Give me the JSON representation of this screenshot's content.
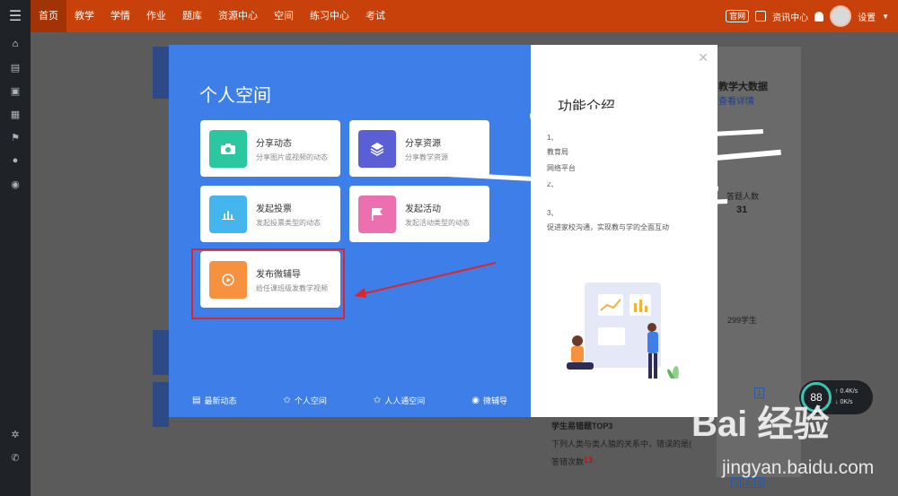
{
  "topnav": {
    "items": [
      {
        "label": "首页"
      },
      {
        "label": "教学"
      },
      {
        "label": "学情"
      },
      {
        "label": "作业"
      },
      {
        "label": "题库"
      },
      {
        "label": "资源中心"
      },
      {
        "label": "空间"
      },
      {
        "label": "练习中心"
      },
      {
        "label": "考试"
      }
    ],
    "official_badge": "官网",
    "resource_center": "资讯中心",
    "settings": "设置"
  },
  "background": {
    "big_data_title": "教学大数据",
    "see_details": "查看详情",
    "students_count": "299学生",
    "top3_title": "学生易错题TOP3",
    "question_text": "下列人类与类人猿的关系中，错误的是(",
    "answer_count_label": "答错次数",
    "answer_count_value": "13",
    "stat_label": "答题人数",
    "stat_value": "31",
    "page_badge": "1",
    "pagination": [
      "1",
      "2",
      "3"
    ]
  },
  "modal": {
    "title": "个人空间",
    "cards": [
      {
        "title": "分享动态",
        "desc": "分享图片或视频的动态",
        "color": "#2ac7a0",
        "icon": "camera-icon"
      },
      {
        "title": "分享资源",
        "desc": "分享教学资源",
        "color": "#5b5fd6",
        "icon": "layers-icon"
      },
      {
        "title": "发起投票",
        "desc": "发起投票类型的动态",
        "color": "#45b5ee",
        "icon": "bar-chart-icon"
      },
      {
        "title": "发起活动",
        "desc": "发起活动类型的动态",
        "color": "#ec6fb0",
        "icon": "flag-icon"
      },
      {
        "title": "发布微辅导",
        "desc": "给任课班级发教学视频",
        "color": "#f6923f",
        "icon": "video-icon"
      }
    ],
    "bottom_nav": [
      {
        "label": "最新动态",
        "icon": "document-icon"
      },
      {
        "label": "个人空间",
        "icon": "star-icon"
      },
      {
        "label": "人人通空间",
        "icon": "star-icon"
      },
      {
        "label": "微辅导",
        "icon": "play-circle-icon"
      }
    ],
    "intro_title": "功能介绍",
    "intro_lines": [
      "1、",
      "教育局",
      "网络平台",
      "2、",
      "3、",
      "促进家校沟通，实现教与学的全面互动"
    ],
    "highlight_color": "#e0242a"
  },
  "network": {
    "percent": "88",
    "up": "0.4K/s",
    "down": "0K/s"
  },
  "watermark": {
    "logo": "Bai 经验",
    "url": "jingyan.baidu.com"
  }
}
